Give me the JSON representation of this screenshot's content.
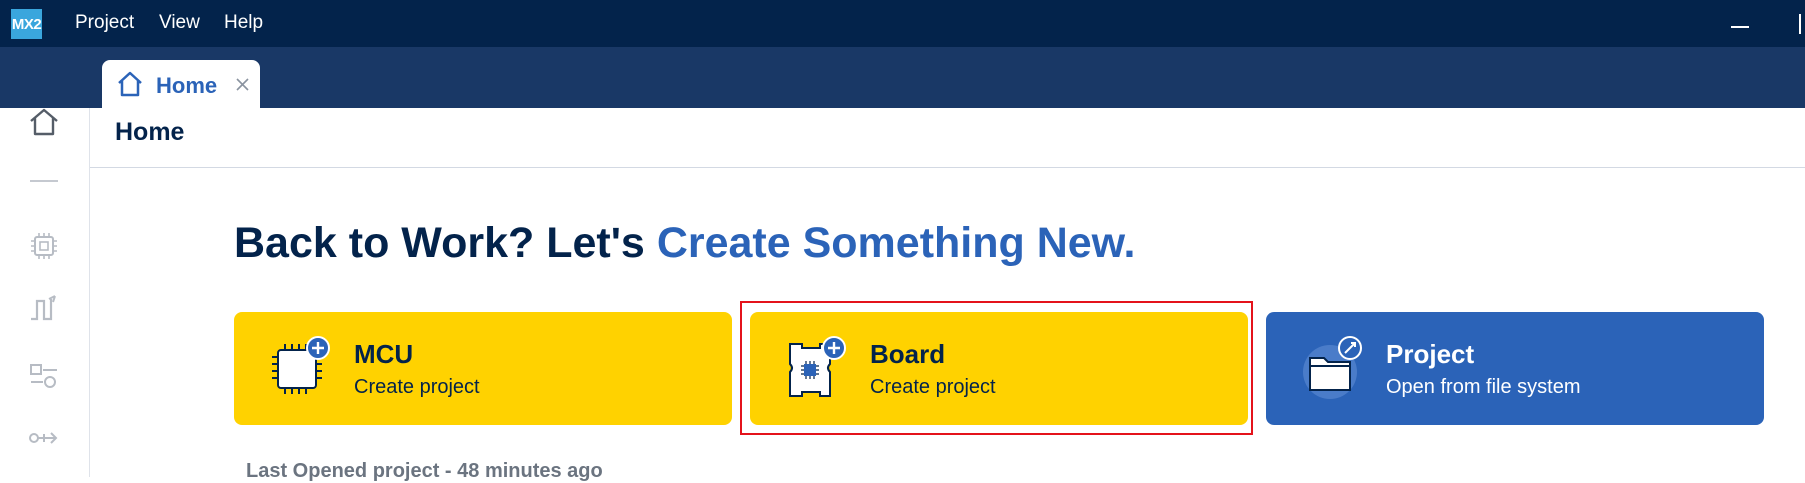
{
  "app": {
    "logo_text": "MX2"
  },
  "menu": {
    "items": [
      "Project",
      "View",
      "Help"
    ]
  },
  "tabs": [
    {
      "label": "Home",
      "icon": "home-icon",
      "closable": true
    }
  ],
  "sidebar": {
    "icons": [
      "home-icon",
      "chip-icon",
      "pinout-icon",
      "clock-config-icon",
      "connectivity-icon"
    ]
  },
  "page": {
    "title": "Home"
  },
  "hero": {
    "prefix": "Back to Work? Let's ",
    "accent": "Create Something New."
  },
  "cards": [
    {
      "title": "MCU",
      "subtitle": "Create project",
      "icon": "mcu-plus-icon",
      "color": "#ffd200"
    },
    {
      "title": "Board",
      "subtitle": "Create project",
      "icon": "board-plus-icon",
      "color": "#ffd200",
      "highlighted": true
    },
    {
      "title": "Project",
      "subtitle": "Open from file system",
      "icon": "folder-open-icon",
      "color": "#2b63b8"
    }
  ],
  "last_opened": {
    "text": "Last Opened project - 48 minutes ago"
  },
  "colors": {
    "menubar": "#03234b",
    "tabbar": "#193866",
    "accent": "#2b63b8",
    "highlight": "#e4131b"
  }
}
